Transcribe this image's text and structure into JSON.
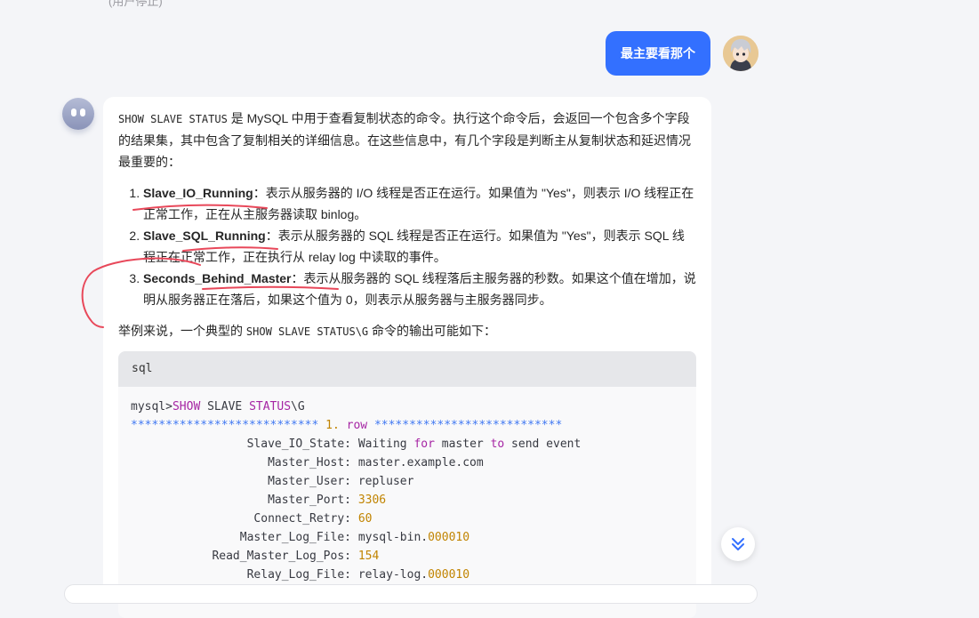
{
  "top_partial_text": "(用户停止)",
  "user_message": "最主要看那个",
  "answer": {
    "intro_cmd": "SHOW SLAVE STATUS",
    "intro_text": " 是 MySQL 中用于查看复制状态的命令。执行这个命令后，会返回一个包含多个字段的结果集，其中包含了复制相关的详细信息。在这些信息中，有几个字段是判断主从复制状态和延迟情况最重要的：",
    "items": [
      {
        "term": "Slave_IO_Running",
        "desc": "：表示从服务器的 I/O 线程是否正在运行。如果值为 \"Yes\"，则表示 I/O 线程正在正常工作，正在从主服务器读取 binlog。"
      },
      {
        "term": "Slave_SQL_Running",
        "desc": "：表示从服务器的 SQL 线程是否正在运行。如果值为 \"Yes\"，则表示 SQL 线程正在正常工作，正在执行从 relay log 中读取的事件。"
      },
      {
        "term": "Seconds_Behind_Master",
        "desc": "：表示从服务器的 SQL 线程落后主服务器的秒数。如果这个值在增加，说明从服务器正在落后，如果这个值为 0，则表示从服务器与主服务器同步。"
      }
    ],
    "example_pre": "举例来说，一个典型的 ",
    "example_cmd": "SHOW SLAVE STATUS\\G",
    "example_post": " 命令的输出可能如下："
  },
  "code": {
    "lang": "sql",
    "prompt": "mysql>",
    "cmd_show": "SHOW",
    "cmd_slave": "SLAVE",
    "cmd_status": "STATUS",
    "cmd_suffix": "\\G",
    "row_stars_left": "***************************",
    "row_num": "1.",
    "row_word": "row",
    "row_stars_right": "***************************",
    "slave_io_state": {
      "k": "Slave_IO_State:",
      "w1": "Waiting",
      "w2": "for",
      "w3": "master",
      "w4": "to",
      "w5": "send event"
    },
    "master_host": {
      "k": "Master_Host:",
      "v": "master.example.com"
    },
    "master_user": {
      "k": "Master_User:",
      "v": "repluser"
    },
    "master_port": {
      "k": "Master_Port:",
      "v": "3306"
    },
    "connect_retry": {
      "k": "Connect_Retry:",
      "v": "60"
    },
    "master_log_file": {
      "k": "Master_Log_File:",
      "v1": "mysql-bin.",
      "v2": "000010"
    },
    "read_master_log_pos": {
      "k": "Read_Master_Log_Pos:",
      "v": "154"
    },
    "relay_log_file": {
      "k": "Relay_Log_File:",
      "v1": "relay-log.",
      "v2": "000010"
    }
  },
  "colors": {
    "accent": "#3370ff",
    "annotation": "#e8485a",
    "keyword": "#a626a4",
    "number": "#c18401"
  },
  "icons": {
    "scroll": "double-chevron-down-icon"
  }
}
